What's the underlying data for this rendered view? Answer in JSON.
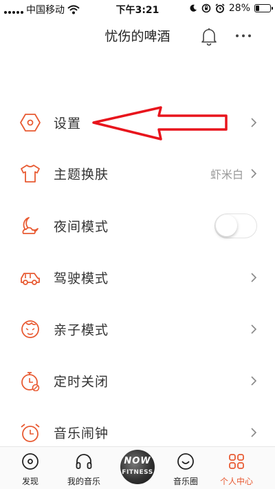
{
  "status_bar": {
    "carrier": "中国移动",
    "time": "下午3:21",
    "battery": "28%",
    "battery_level": 0.28,
    "icons": [
      "signal-icon",
      "wifi-icon",
      "moon-icon",
      "rotation-lock-icon",
      "alarm-icon",
      "battery-icon"
    ]
  },
  "header": {
    "title": "忧伤的啤酒",
    "icons": [
      "bell-icon",
      "more-icon"
    ]
  },
  "menu": {
    "items": [
      {
        "label": "设置",
        "icon": "hexagon-gear-icon",
        "control": "chevron"
      },
      {
        "label": "主题换肤",
        "icon": "tshirt-icon",
        "value": "虾米白",
        "control": "chevron"
      },
      {
        "label": "夜间模式",
        "icon": "moon-cloud-icon",
        "control": "toggle",
        "toggle_on": false
      },
      {
        "label": "驾驶模式",
        "icon": "car-icon",
        "control": "chevron"
      },
      {
        "label": "亲子模式",
        "icon": "baby-face-icon",
        "control": "chevron"
      },
      {
        "label": "定时关闭",
        "icon": "stopwatch-icon",
        "control": "chevron"
      },
      {
        "label": "音乐闹钟",
        "icon": "alarm-clock-icon",
        "control": "chevron"
      }
    ]
  },
  "annotation": {
    "type": "red-outline-arrow",
    "points_to": "设置",
    "color": "#e8141c"
  },
  "tabbar": {
    "tabs": [
      {
        "label": "发现",
        "icon": "discover-icon"
      },
      {
        "label": "我的音乐",
        "icon": "headphones-icon"
      },
      {
        "label": "",
        "icon": "now-playing-disc",
        "disc_text_1": "NOW",
        "disc_text_2": "FITNESS"
      },
      {
        "label": "音乐圈",
        "icon": "smile-icon"
      },
      {
        "label": "个人中心",
        "icon": "profile-grid-icon",
        "active": true
      }
    ]
  },
  "colors": {
    "accent": "#e85a32",
    "text": "#333333",
    "secondary_text": "#999999",
    "arrow": "#e8141c"
  }
}
